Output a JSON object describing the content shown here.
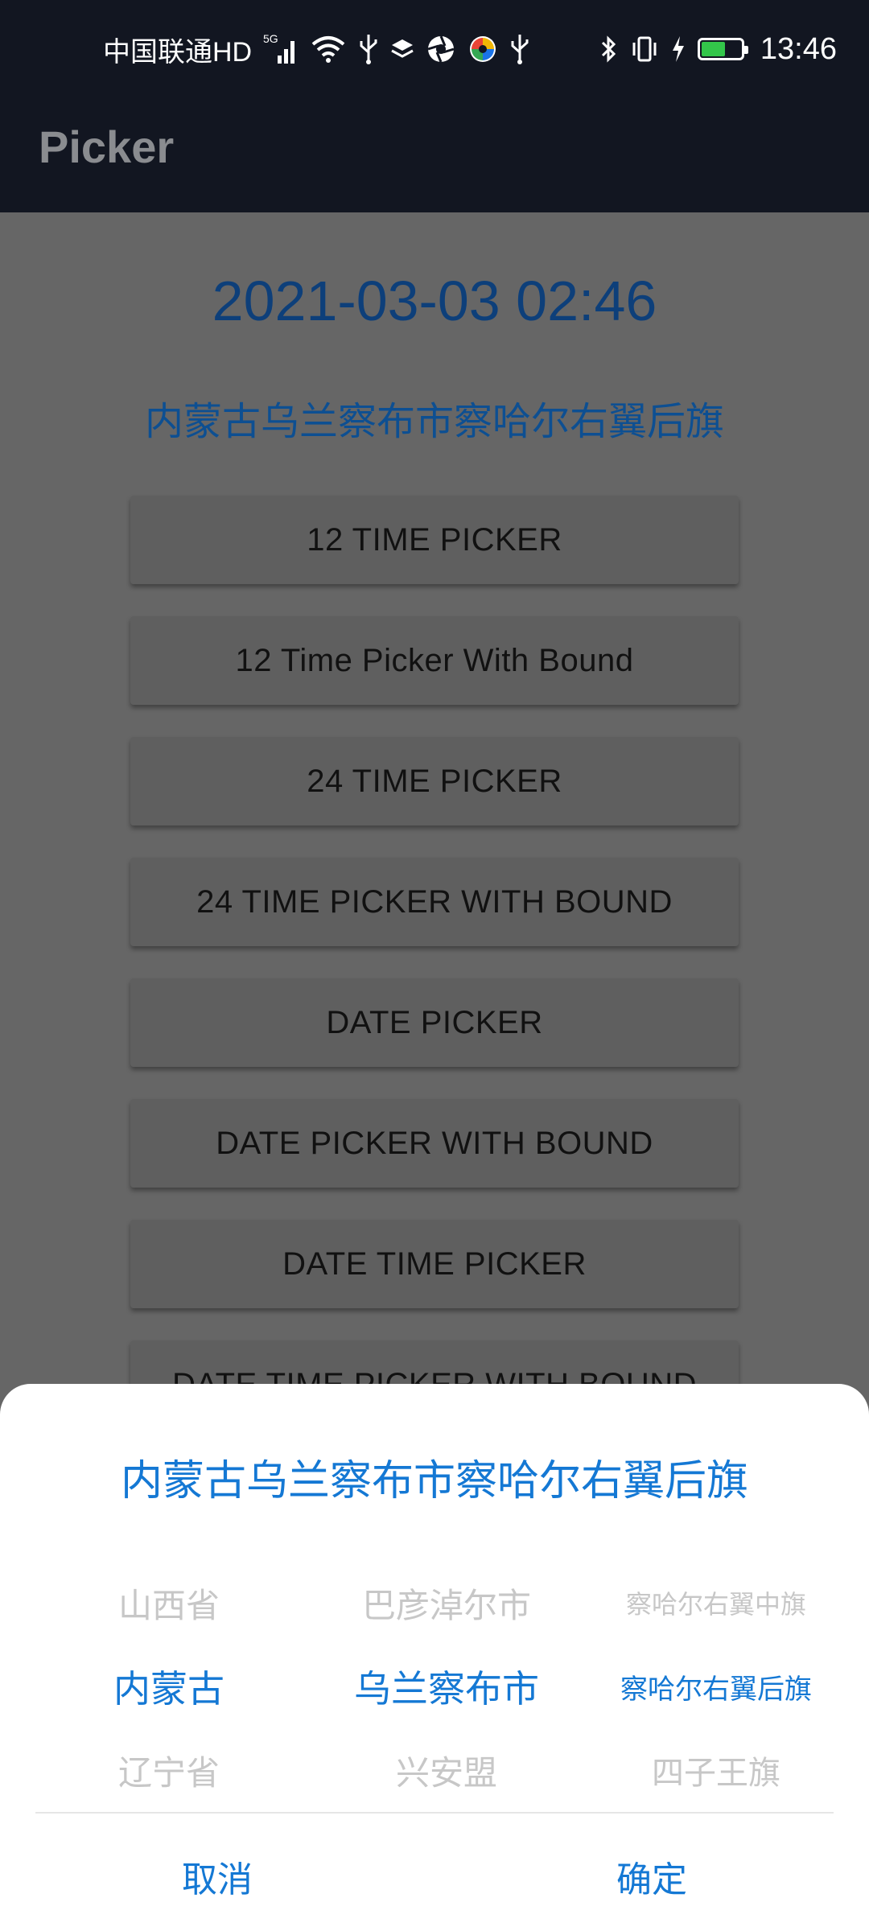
{
  "status_bar": {
    "carrier": "中国联通HD",
    "network": "5G",
    "time": "13:46"
  },
  "app_bar": {
    "title": "Picker"
  },
  "main": {
    "datetime": "2021-03-03 02:46",
    "address": "内蒙古乌兰察布市察哈尔右翼后旗",
    "buttons": [
      "12 TIME PICKER",
      "12 Time Picker With Bound",
      "24 TIME PICKER",
      "24 TIME PICKER WITH BOUND",
      "DATE PICKER",
      "DATE PICKER WITH BOUND",
      "DATE TIME PICKER",
      "DATE TIME PICKER WITH BOUND"
    ]
  },
  "sheet": {
    "title": "内蒙古乌兰察布市察哈尔右翼后旗",
    "province_column": [
      "山西省",
      "内蒙古",
      "辽宁省"
    ],
    "city_column": [
      "巴彦淖尔市",
      "乌兰察布市",
      "兴安盟"
    ],
    "district_column": [
      "察哈尔右翼中旗",
      "察哈尔右翼后旗",
      "四子王旗"
    ],
    "cancel_label": "取消",
    "confirm_label": "确定"
  },
  "colors": {
    "accent": "#1478d4",
    "status_bar_bg": "#121621",
    "scrim_bg": "#666666",
    "battery_fill": "#33c64a"
  }
}
